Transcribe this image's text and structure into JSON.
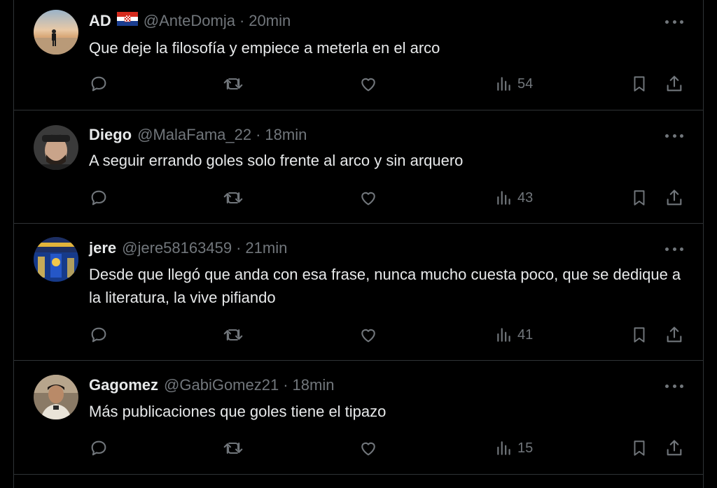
{
  "tweets": [
    {
      "name": "AD",
      "has_flag": true,
      "flag": "croatia-flag",
      "handle": "@AnteDomja",
      "separator": "·",
      "time": "20min",
      "text": "Que deje la filosofía y empiece a meterla en el arco",
      "views": "54",
      "avatar": "beach-sunset-person"
    },
    {
      "name": "Diego",
      "has_flag": false,
      "handle": "@MalaFama_22",
      "separator": "·",
      "time": "18min",
      "text": "A seguir errando goles solo frente al arco y sin arquero",
      "views": "43",
      "avatar": "man-with-cap"
    },
    {
      "name": "jere",
      "has_flag": false,
      "handle": "@jere58163459",
      "separator": "·",
      "time": "21min",
      "text": "Desde que llegó que anda con esa frase, nunca mucho cuesta poco, que se dedique a la literatura, la vive pifiando",
      "views": "41",
      "avatar": "blue-stadium-crowd"
    },
    {
      "name": "Gagomez",
      "has_flag": false,
      "handle": "@GabiGomez21",
      "separator": "·",
      "time": "18min",
      "text": "Más publicaciones que goles tiene el tipazo",
      "views": "15",
      "avatar": "man-selfie"
    }
  ],
  "icons": {
    "reply": "reply-icon",
    "retweet": "retweet-icon",
    "like": "like-icon",
    "views": "views-icon",
    "bookmark": "bookmark-icon",
    "share": "share-icon",
    "more": "more-icon"
  },
  "colors": {
    "background": "#000000",
    "text": "#e7e9ea",
    "secondary": "#71767b",
    "divider": "#2f3336"
  }
}
